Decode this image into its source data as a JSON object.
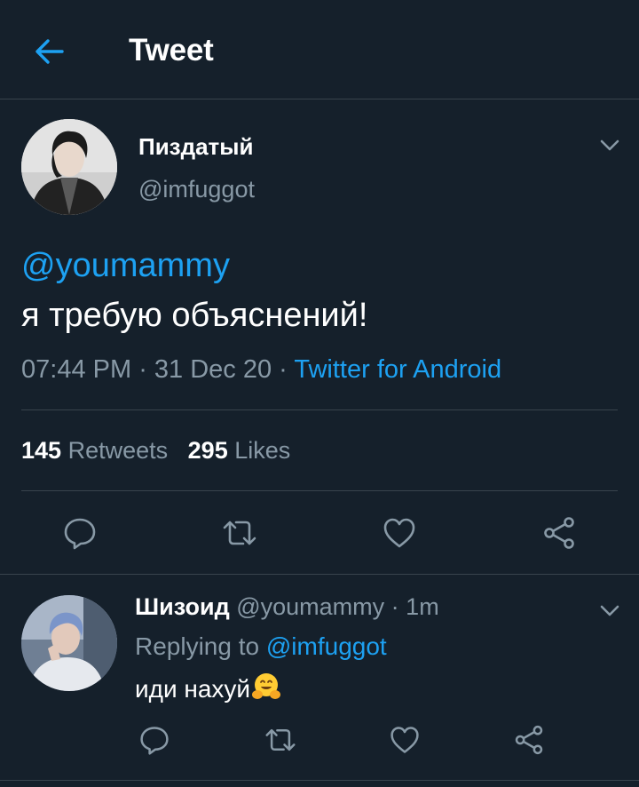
{
  "header": {
    "title": "Tweet",
    "back_icon": "arrow-left-icon"
  },
  "tweet": {
    "display_name": "Пиздатый",
    "handle": "@imfuggot",
    "mention": "@youmammy",
    "text": "я требую объяснений!",
    "time": "07:44 PM",
    "separator": " · ",
    "date": "31 Dec 20",
    "source": "Twitter for Android",
    "retweets_count": "145",
    "retweets_label": "Retweets",
    "likes_count": "295",
    "likes_label": "Likes",
    "actions": [
      "reply-icon",
      "retweet-icon",
      "like-icon",
      "share-icon"
    ]
  },
  "reply": {
    "display_name": "Шизоид",
    "handle": "@youmammy",
    "separator": " · ",
    "time_ago": "1m",
    "replying_prefix": "Replying to ",
    "replying_to": "@imfuggot",
    "text": "иди нахуй",
    "emoji": "hugging-face-emoji",
    "actions": [
      "reply-icon",
      "retweet-icon",
      "like-icon",
      "share-icon"
    ]
  },
  "colors": {
    "background": "#15202b",
    "divider": "#38444d",
    "accent": "#1da1f2",
    "secondary_text": "#8899a6",
    "primary_text": "#ffffff"
  }
}
